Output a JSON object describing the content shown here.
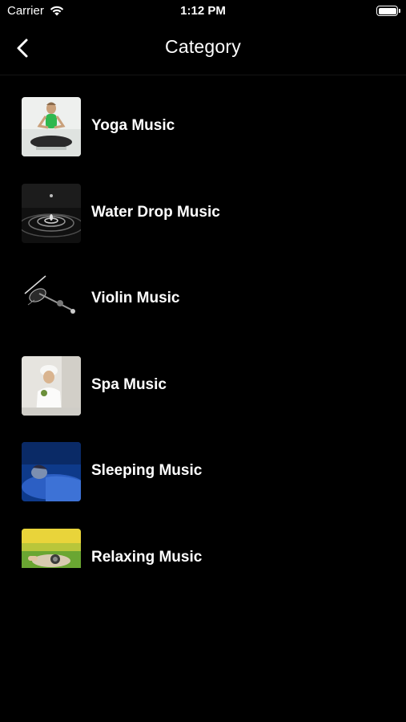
{
  "status_bar": {
    "carrier": "Carrier",
    "time": "1:12 PM"
  },
  "nav": {
    "title": "Category",
    "back_icon": "chevron-left-icon"
  },
  "categories": [
    {
      "label": "Yoga Music",
      "thumbnail": "yoga-thumbnail"
    },
    {
      "label": "Water Drop Music",
      "thumbnail": "water-drop-thumbnail"
    },
    {
      "label": "Violin Music",
      "thumbnail": "violin-thumbnail"
    },
    {
      "label": "Spa Music",
      "thumbnail": "spa-thumbnail"
    },
    {
      "label": "Sleeping Music",
      "thumbnail": "sleeping-thumbnail"
    },
    {
      "label": "Relaxing Music",
      "thumbnail": "relaxing-thumbnail"
    }
  ],
  "colors": {
    "background": "#000000",
    "text": "#ffffff"
  }
}
